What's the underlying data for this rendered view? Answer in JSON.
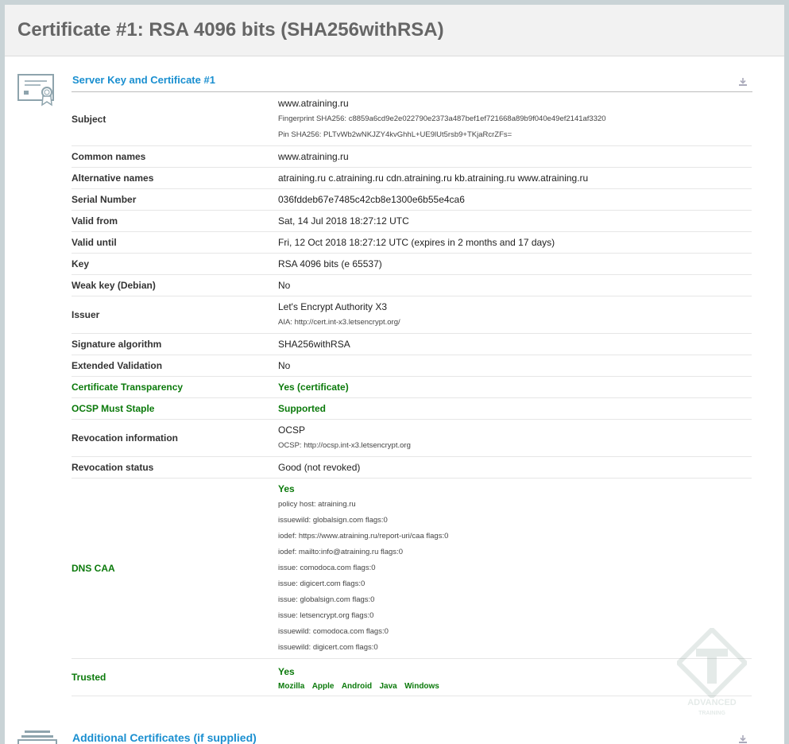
{
  "header": {
    "title": "Certificate #1: RSA 4096 bits (SHA256withRSA)"
  },
  "section1": {
    "title": "Server Key and Certificate #1"
  },
  "section2": {
    "title": "Additional Certificates (if supplied)"
  },
  "rows": {
    "subject": {
      "label": "Subject",
      "value": "www.atraining.ru",
      "fingerprint": "Fingerprint SHA256: c8859a6cd9e2e022790e2373a487bef1ef721668a89b9f040e49ef2141af3320",
      "pin": "Pin SHA256: PLTvWb2wNKJZY4kvGhhL+UE9lUt5rsb9+TKjaRcrZFs="
    },
    "common_names": {
      "label": "Common names",
      "value": "www.atraining.ru"
    },
    "alt_names": {
      "label": "Alternative names",
      "value": "atraining.ru c.atraining.ru cdn.atraining.ru kb.atraining.ru www.atraining.ru"
    },
    "serial": {
      "label": "Serial Number",
      "value": "036fddeb67e7485c42cb8e1300e6b55e4ca6"
    },
    "valid_from": {
      "label": "Valid from",
      "value": "Sat, 14 Jul 2018 18:27:12 UTC"
    },
    "valid_until": {
      "label": "Valid until",
      "value": "Fri, 12 Oct 2018 18:27:12 UTC (expires in 2 months and 17 days)"
    },
    "key": {
      "label": "Key",
      "value": "RSA 4096 bits (e 65537)"
    },
    "weak_key": {
      "label": "Weak key (Debian)",
      "value": "No"
    },
    "issuer": {
      "label": "Issuer",
      "value": "Let's Encrypt Authority X3",
      "aia": "AIA: http://cert.int-x3.letsencrypt.org/"
    },
    "sig_alg": {
      "label": "Signature algorithm",
      "value": "SHA256withRSA"
    },
    "ev": {
      "label": "Extended Validation",
      "value": "No"
    },
    "ct": {
      "label": "Certificate Transparency",
      "value": "Yes (certificate)"
    },
    "ocsp_staple": {
      "label": "OCSP Must Staple",
      "value": "Supported"
    },
    "revocation_info": {
      "label": "Revocation information",
      "value": "OCSP",
      "ocsp": "OCSP: http://ocsp.int-x3.letsencrypt.org"
    },
    "revocation_status": {
      "label": "Revocation status",
      "value": "Good (not revoked)"
    },
    "dns_caa": {
      "label": "DNS CAA",
      "value": "Yes",
      "records": [
        "policy host: atraining.ru",
        "issuewild: globalsign.com flags:0",
        "iodef: https://www.atraining.ru/report-uri/caa flags:0",
        "iodef: mailto:info@atraining.ru flags:0",
        "issue: comodoca.com flags:0",
        "issue: digicert.com flags:0",
        "issue: globalsign.com flags:0",
        "issue: letsencrypt.org flags:0",
        "issuewild: comodoca.com flags:0",
        "issuewild: digicert.com flags:0"
      ]
    },
    "trusted": {
      "label": "Trusted",
      "value": "Yes",
      "stores": [
        "Mozilla",
        "Apple",
        "Android",
        "Java",
        "Windows"
      ]
    }
  },
  "watermark": {
    "text": "ADVANCED",
    "subtext": "TRAINING"
  },
  "icons": {
    "certificate": "certificate-icon",
    "download": "download-icon",
    "chain": "certificate-chain-icon"
  },
  "colors": {
    "link": "#1a8fd0",
    "good": "#0b7a0b",
    "header_bg": "#f2f2f2",
    "frame": "#c9d3d6"
  }
}
